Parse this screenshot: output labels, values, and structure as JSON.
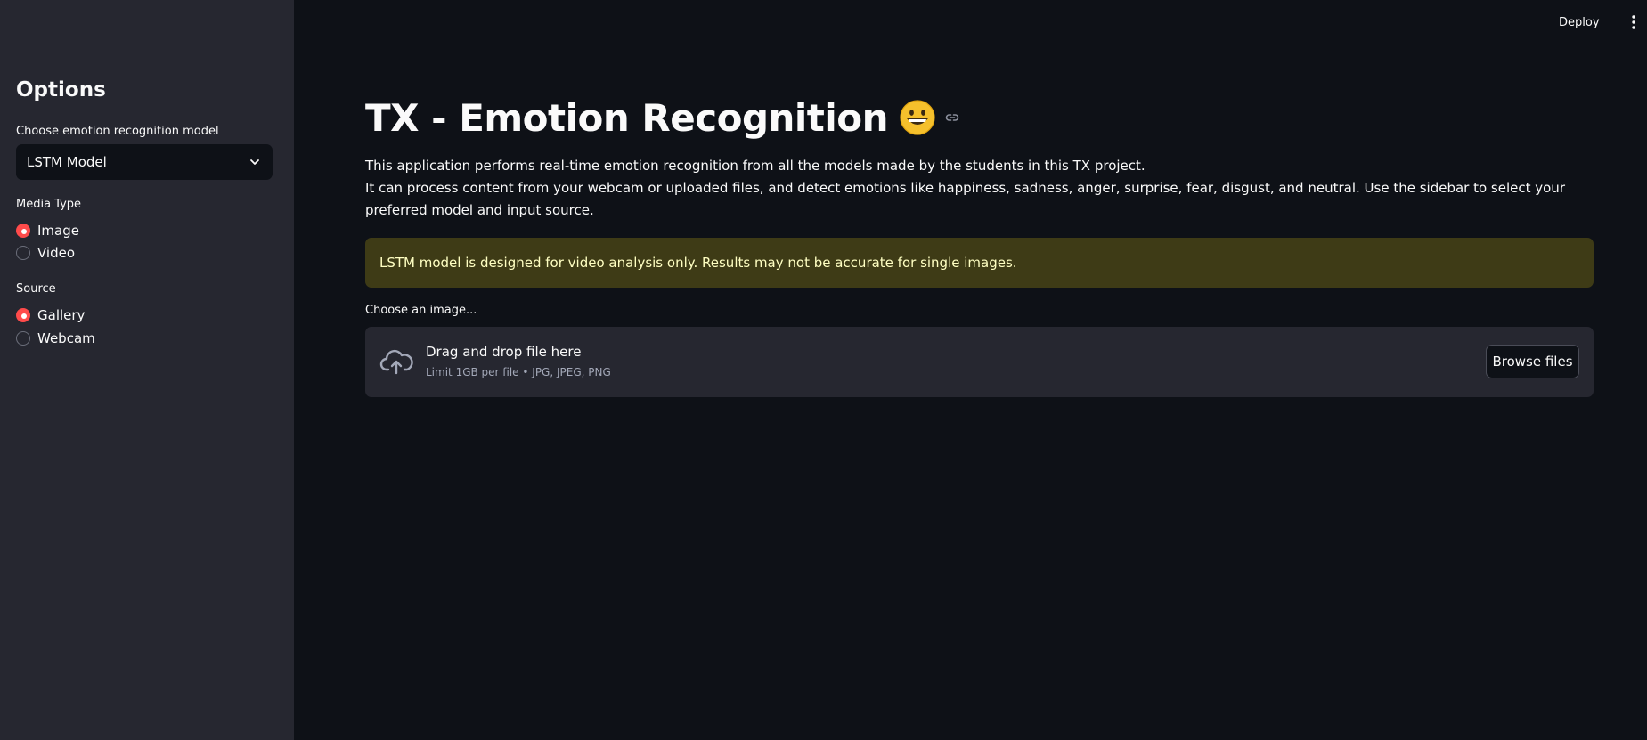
{
  "header": {
    "deploy_label": "Deploy",
    "menu_icon": "kebab-menu-icon"
  },
  "sidebar": {
    "title": "Options",
    "model_select": {
      "label": "Choose emotion recognition model",
      "value": "LSTM Model"
    },
    "media_type": {
      "label": "Media Type",
      "options": [
        {
          "label": "Image",
          "checked": true
        },
        {
          "label": "Video",
          "checked": false
        }
      ]
    },
    "source": {
      "label": "Source",
      "options": [
        {
          "label": "Gallery",
          "checked": true
        },
        {
          "label": "Webcam",
          "checked": false
        }
      ]
    }
  },
  "main": {
    "title": "TX - Emotion Recognition",
    "title_emoji": "grinning-face-icon",
    "description": [
      "This application performs real-time emotion recognition from all the models made by the students in this TX project.",
      "It can process content from your webcam or uploaded files, and detect emotions like happiness, sadness, anger, surprise, fear, disgust, and neutral. Use the sidebar to select your preferred model and input source."
    ],
    "warning": "LSTM model is designed for video analysis only. Results may not be accurate for single images.",
    "uploader": {
      "label": "Choose an image...",
      "drop_title": "Drag and drop file here",
      "limit_text": "Limit 1GB per file • JPG, JPEG, PNG",
      "browse_label": "Browse files"
    }
  },
  "colors": {
    "background": "#0e1117",
    "sidebar": "#262730",
    "accent": "#ff4b4b",
    "warning_bg": "#3e3b16",
    "warning_text": "#ffffc2"
  }
}
